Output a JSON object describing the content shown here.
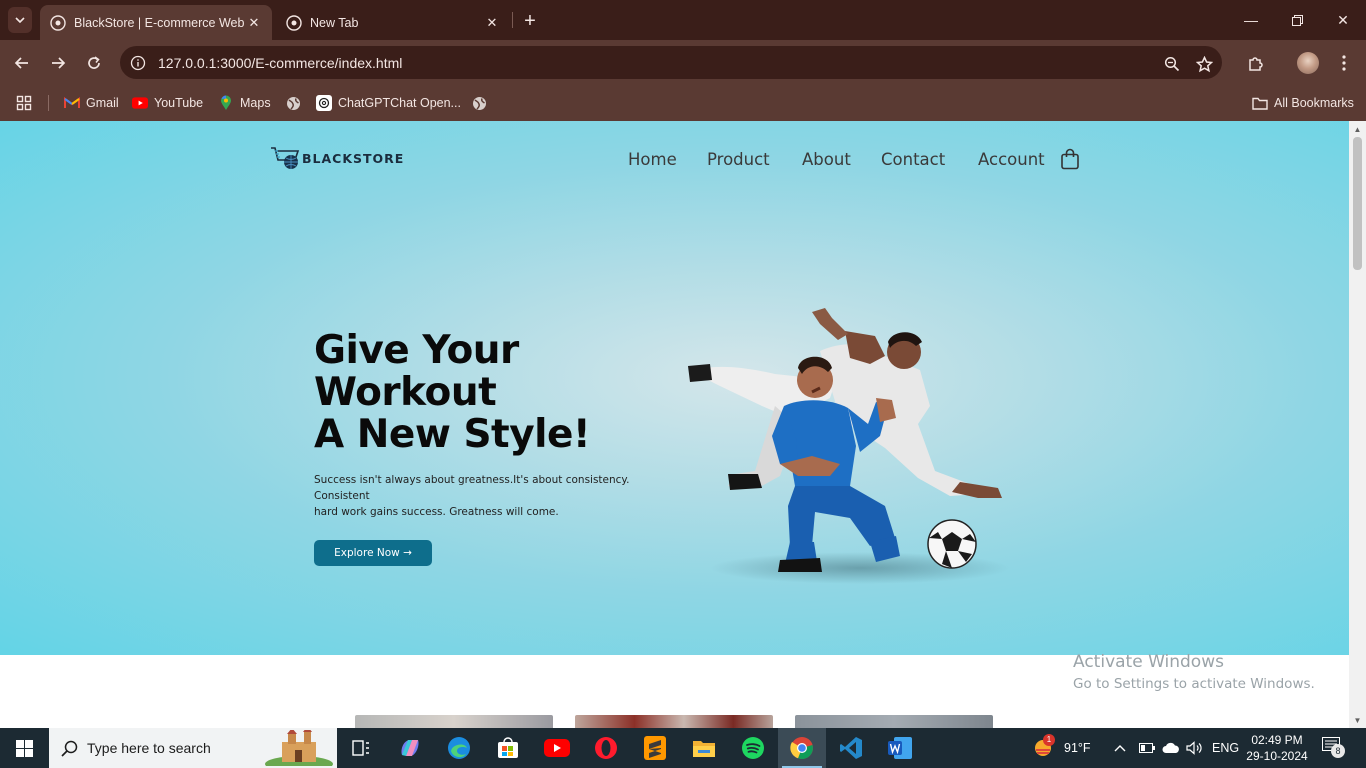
{
  "browser": {
    "tabs": [
      {
        "title": "BlackStore | E-commerce Websit",
        "active": true
      },
      {
        "title": "New Tab",
        "active": false
      }
    ],
    "url": "127.0.0.1:3000/E-commerce/index.html",
    "bookmarks": [
      {
        "label": "Gmail",
        "icon": "gmail-icon"
      },
      {
        "label": "YouTube",
        "icon": "youtube-icon"
      },
      {
        "label": "Maps",
        "icon": "maps-icon"
      },
      {
        "label": "",
        "icon": "globe-icon"
      },
      {
        "label": "ChatGPTChat Open...",
        "icon": "chatgpt-icon"
      },
      {
        "label": "",
        "icon": "globe-icon"
      }
    ],
    "all_bookmarks_label": "All Bookmarks"
  },
  "site": {
    "logo_text": "BLACKSTORE",
    "nav": [
      "Home",
      "Product",
      "About",
      "Contact",
      "Account"
    ],
    "hero": {
      "headline": [
        "Give Your",
        "Workout",
        "A New Style!"
      ],
      "subtext": [
        "Success isn't always about greatness.It's about consistency. Consistent",
        "hard work gains success. Greatness will come."
      ],
      "cta": "Explore Now →"
    }
  },
  "watermark": {
    "title": "Activate Windows",
    "subtitle": "Go to Settings to activate Windows."
  },
  "taskbar": {
    "search_placeholder": "Type here to search",
    "weather": "91°F",
    "weather_badge": "1",
    "language": "ENG",
    "time": "02:49 PM",
    "date": "29-10-2024",
    "notification_count": "8"
  },
  "colors": {
    "chrome_dark": "#3a1e19",
    "chrome_mid": "#5a3a33",
    "hero_bg": "#63d4e6",
    "cta_bg": "#0e6e8c",
    "taskbar_bg": "#1c2a33"
  }
}
